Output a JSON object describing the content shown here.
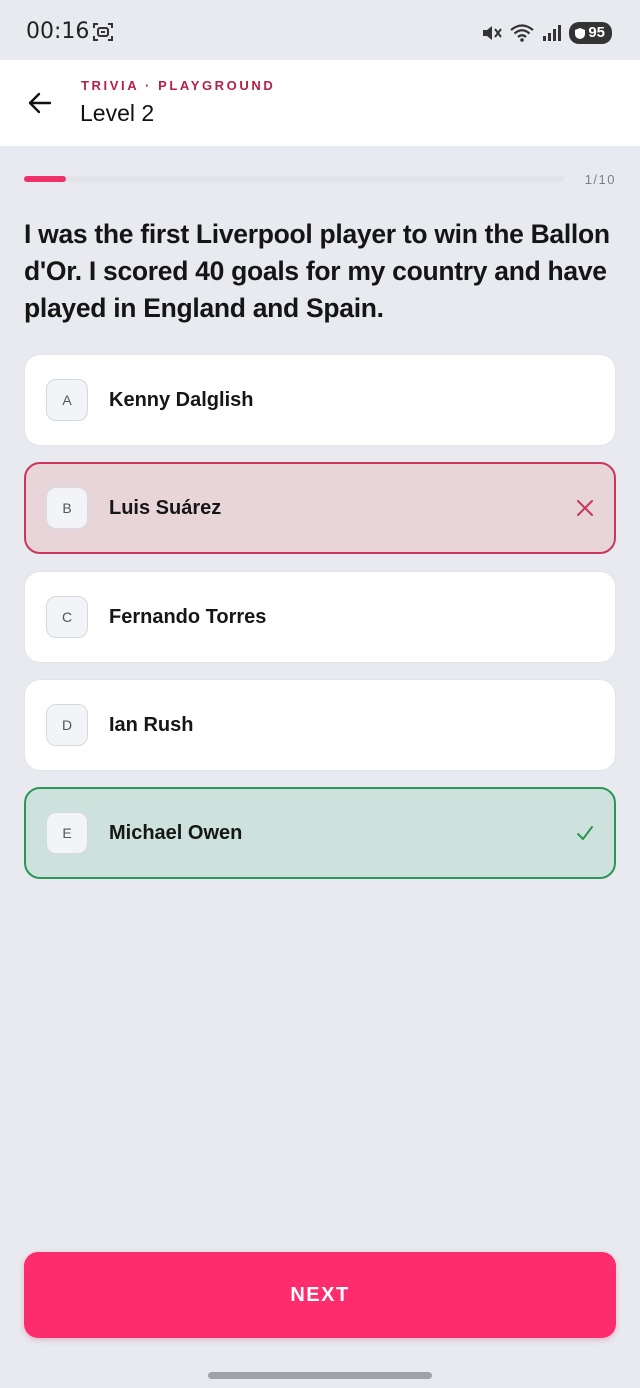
{
  "status_bar": {
    "time": "00:16",
    "battery": "95",
    "icons": [
      "screen-record-icon",
      "mute-vibrate-icon",
      "wifi-icon",
      "signal-icon",
      "battery-icon"
    ]
  },
  "header": {
    "eyebrow": "TRIVIA · PLAYGROUND",
    "title": "Level 2",
    "back_icon": "arrow-left-icon"
  },
  "progress": {
    "counter": "1/10",
    "fraction": 0.077,
    "color": "#f0306a"
  },
  "question": "I was the first Liverpool player to win the Ballon d'Or. I scored 40 goals for my country and have played in England and Spain.",
  "options": [
    {
      "letter": "A",
      "label": "Kenny Dalglish",
      "state": "default"
    },
    {
      "letter": "B",
      "label": "Luis Suárez",
      "state": "wrong",
      "icon": "x-icon"
    },
    {
      "letter": "C",
      "label": "Fernando Torres",
      "state": "default"
    },
    {
      "letter": "D",
      "label": "Ian Rush",
      "state": "default"
    },
    {
      "letter": "E",
      "label": "Michael Owen",
      "state": "correct",
      "icon": "check-icon"
    }
  ],
  "next_button": {
    "label": "NEXT",
    "color": "#fd2c6c"
  },
  "colors": {
    "wrong_border": "#c8365a",
    "wrong_bg": "#e8d5da",
    "correct_border": "#2c9656",
    "correct_bg": "#cde2dc",
    "accent_text": "#b71f45"
  }
}
